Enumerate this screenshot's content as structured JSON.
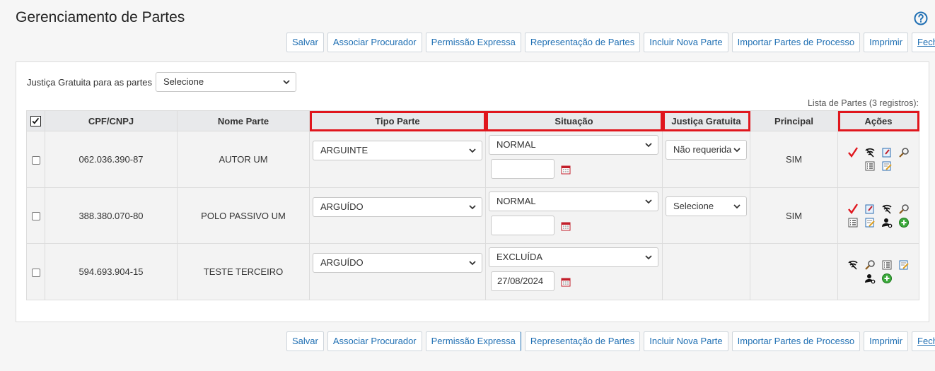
{
  "page": {
    "title": "Gerenciamento de Partes"
  },
  "toolbar": {
    "salvar": "Salvar",
    "associar": "Associar Procurador",
    "permissao": "Permissão Expressa",
    "representacao": "Representação de Partes",
    "incluir": "Incluir Nova Parte",
    "importar": "Importar Partes de Processo",
    "imprimir": "Imprimir",
    "fechar": "Fechar"
  },
  "justica_gratuita_filter": {
    "label": "Justiça Gratuita para as partes",
    "value": "Selecione"
  },
  "table": {
    "caption": "Lista de Partes (3 registros):",
    "headers": {
      "cpf": "CPF/CNPJ",
      "nome": "Nome Parte",
      "tipo": "Tipo Parte",
      "situacao": "Situação",
      "justica": "Justiça Gratuita",
      "principal": "Principal",
      "acoes": "Ações"
    },
    "rows": [
      {
        "cpf": "062.036.390-87",
        "nome": "AUTOR UM",
        "tipo": "ARGUINTE",
        "situacao": "NORMAL",
        "data": "",
        "justica": "Não requerida",
        "principal": "SIM"
      },
      {
        "cpf": "388.380.070-80",
        "nome": "POLO PASSIVO UM",
        "tipo": "ARGUÍDO",
        "situacao": "NORMAL",
        "data": "",
        "justica": "Selecione",
        "principal": "SIM"
      },
      {
        "cpf": "594.693.904-15",
        "nome": "TESTE TERCEIRO",
        "tipo": "ARGUÍDO",
        "situacao": "EXCLUÍDA",
        "data": "27/08/2024",
        "justica": "",
        "principal": ""
      }
    ]
  },
  "colors": {
    "link_blue": "#1f6fb3",
    "highlight_red": "#e0161d",
    "header_bg": "#e8e9eb",
    "row_bg": "#f3f3f3"
  }
}
